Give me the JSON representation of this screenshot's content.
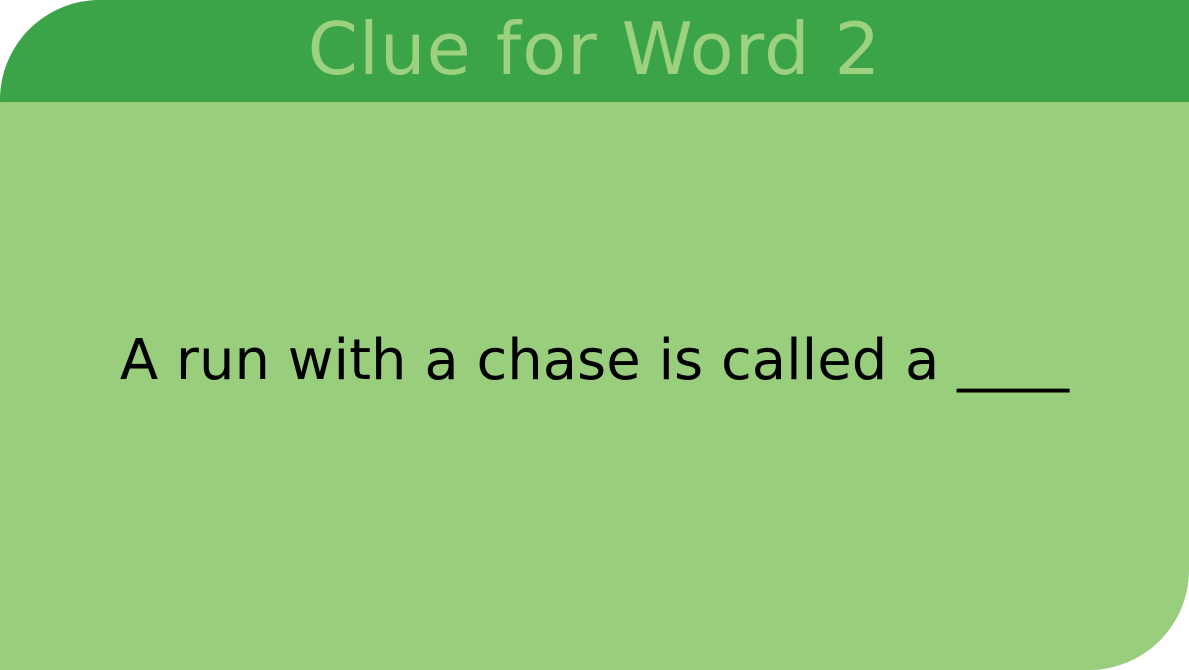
{
  "card": {
    "title": "Clue for Word 2",
    "clue_text": "A run with a chase is called a ____"
  },
  "colors": {
    "header_bg": "#3ca448",
    "body_bg": "#99ce7d",
    "title_text": "#9bd17f",
    "clue_text": "#000000"
  }
}
